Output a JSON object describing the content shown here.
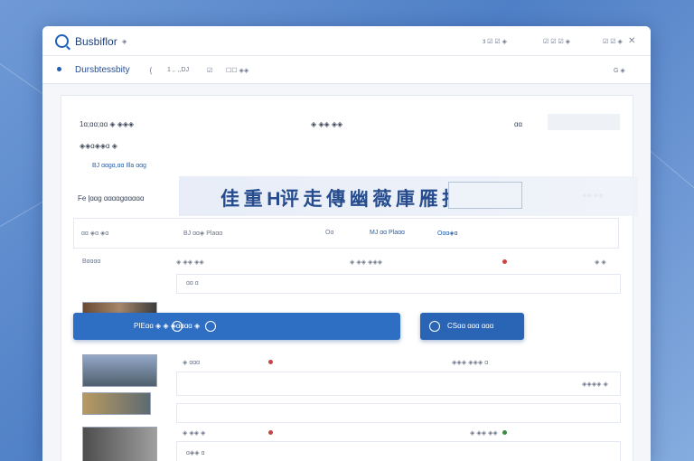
{
  "app": {
    "title": "Busbiflor",
    "top_right": [
      "ӟ ☑ ☑ ◈",
      "☑ ☑ ☑ ◈",
      "☑ ☑ ◈"
    ]
  },
  "toolbar": {
    "workspace": "Dursbtessbity",
    "menu_a": "1 ,. ,,DJ",
    "menu_b": "☑",
    "menu_c": "☐☐ ◈◈",
    "right": "G ◈"
  },
  "panel": {
    "header_left": "1ɑ;ɑɑ;ɑɑ ◈ ◈◈◈",
    "header_middle": "◈ ◈◈ ◈◈",
    "header_right": "ɑɑ",
    "sub_label": "◈◈ɑ◈◈ɑ ◈",
    "sub_link": "BJ ɑɑɡɑ,ɑɑ Illa ɑɑɡ",
    "section_title": "Fe ɭɑɑɡ ɑɑɑɑɡɑɑɑɑɑ",
    "section_right": "◈◈ ◈◈"
  },
  "banner": {
    "text": "佳 重 Η评 走 傳 幽 薇 庫 雁 抱"
  },
  "columns": [
    "ɑɑ ◈ɑ ◈ɑ",
    "BJ ɑɑ◈ Plaɑɑ",
    "Oɑ",
    "MJ ɑɑ Plaɑɑ",
    "Oɑɑ◈ɑ"
  ],
  "rows": [
    {
      "left": "Bɑɑɑɑ",
      "values": [
        "◈ ◈◈ ◈◈",
        "◈ ◈◈ ◈◈◈",
        "◈ ◈"
      ],
      "detail": "ɑɑ ɑ"
    },
    {
      "left": "◈ ɑɑɑ",
      "values": [
        "ɑ",
        "◈◈◈ ◈◈◈ ɑ",
        "◈◈◈◈ ◈"
      ]
    },
    {
      "left": "◈ ◈◈ ◈",
      "values": [
        "◈",
        "◈ ◈◈ ◈◈",
        "◈"
      ],
      "detail": "ɑ◈◈ ɑ"
    }
  ],
  "buttons": {
    "primary": "PIEɑɑ ◈ ◈ ◈ɑɑɑɑ ◈",
    "secondary": "CSɑɑ ɑɑɑ ɑɑɑ"
  },
  "colors": {
    "accent": "#2f6fc3",
    "bg": "#f4f6fa",
    "status_red": "#c94545"
  }
}
